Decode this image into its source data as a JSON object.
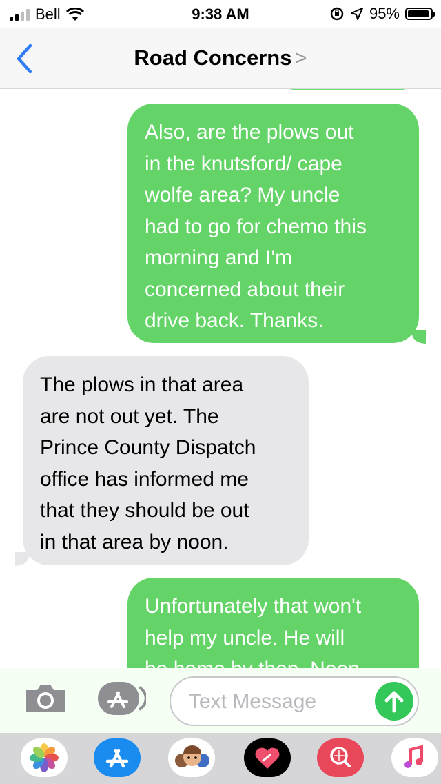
{
  "status": {
    "carrier": "Bell",
    "time": "9:38 AM",
    "battery": "95%",
    "battery_level": 0.95
  },
  "nav": {
    "title": "Road Concerns",
    "chevron": ">"
  },
  "messages": [
    {
      "direction": "outgoing",
      "lines": [
        "Also, are the plows out",
        "in the knutsford/ cape",
        "wolfe area? My uncle",
        "had to go for chemo this",
        "morning and I'm",
        "concerned about their",
        "drive back. Thanks."
      ]
    },
    {
      "direction": "incoming",
      "lines": [
        "The plows in that area",
        "are not out yet. The",
        "Prince County Dispatch",
        "office has informed me",
        "that they should be out",
        "in that area by noon."
      ]
    },
    {
      "direction": "outgoing",
      "lines": [
        "Unfortunately that won't",
        "help my uncle. He will",
        "be home by then. Noon"
      ]
    }
  ],
  "composer": {
    "placeholder": "Text Message"
  },
  "drawer_apps": [
    "photos-icon",
    "app-store-icon",
    "memoji-icon",
    "digital-touch-icon",
    "images-search-icon",
    "music-icon"
  ],
  "colors": {
    "outgoing_bubble": "#65d468",
    "incoming_bubble": "#e7e7ea",
    "accent_blue": "#2f7cf6",
    "send_green": "#34c759"
  }
}
